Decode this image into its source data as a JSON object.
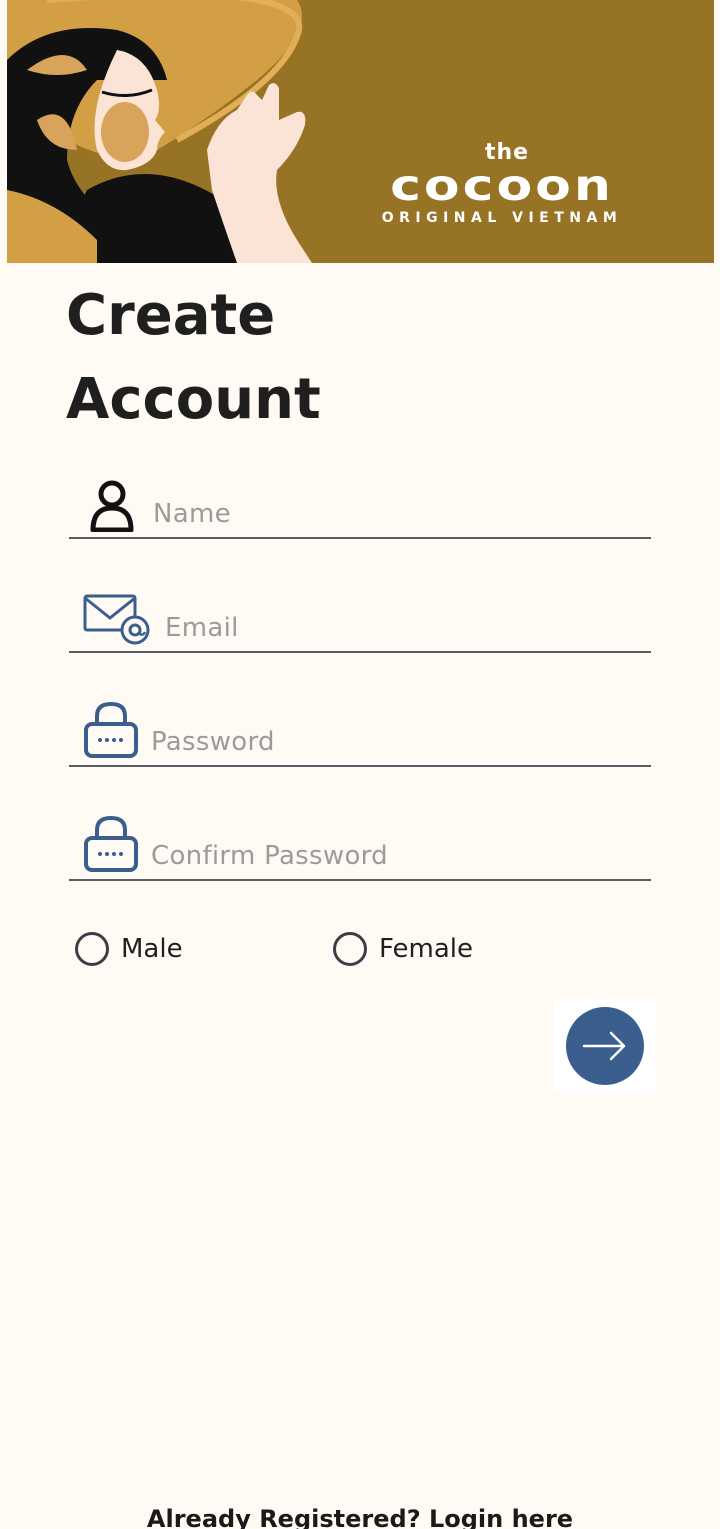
{
  "banner": {
    "brand_top": "the",
    "brand_name": "cocoon",
    "brand_sub": "ORIGINAL VIETNAM",
    "bg_color": "#977325"
  },
  "page": {
    "title_line1": "Create",
    "title_line2": "Account"
  },
  "form": {
    "name": {
      "placeholder": "Name",
      "icon": "person-icon"
    },
    "email": {
      "placeholder": "Email",
      "icon": "email-at-icon"
    },
    "password": {
      "placeholder": "Password",
      "icon": "lock-icon"
    },
    "confirm_password": {
      "placeholder": "Confirm Password",
      "icon": "lock-icon"
    },
    "gender": {
      "options": [
        {
          "label": "Male",
          "selected": false
        },
        {
          "label": "Female",
          "selected": false
        }
      ]
    },
    "next_icon": "arrow-right-icon"
  },
  "footer": {
    "login_text": "Already Registered? Login here"
  },
  "colors": {
    "accent": "#3a5f8f",
    "background": "#fffbf4"
  }
}
